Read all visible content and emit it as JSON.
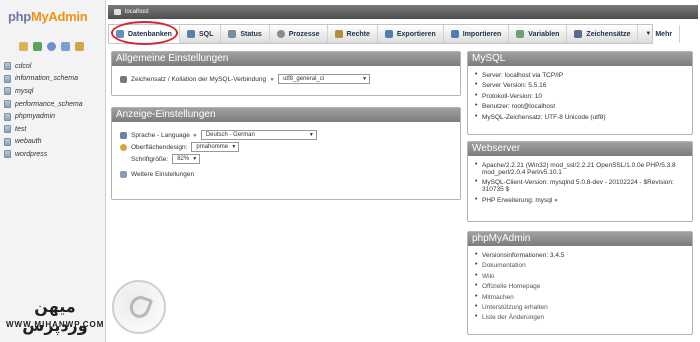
{
  "brand": {
    "php": "php",
    "myadmin": "MyAdmin"
  },
  "left_icons": [
    "home-icon",
    "exit-icon",
    "help-icon",
    "docs-icon",
    "settings-icon"
  ],
  "databases": [
    "cdcol",
    "information_schema",
    "mysql",
    "performance_schema",
    "phpmyadmin",
    "test",
    "webauth",
    "wordpress"
  ],
  "watermark": {
    "text": "میهن وردپرس",
    "url": "WWW.MIHANWP.COM"
  },
  "server_bar": {
    "label": "localhost"
  },
  "tabs": [
    {
      "label": "Datenbanken",
      "icon": "database-icon",
      "color": "#6b8fb7"
    },
    {
      "label": "SQL",
      "icon": "sql-icon",
      "color": "#5a7fa8"
    },
    {
      "label": "Status",
      "icon": "status-icon",
      "color": "#7a8aa0"
    },
    {
      "label": "Prozesse",
      "icon": "process-icon",
      "color": "#8a8a8a"
    },
    {
      "label": "Rechte",
      "icon": "rights-icon",
      "color": "#b0903a"
    },
    {
      "label": "Exportieren",
      "icon": "export-icon",
      "color": "#4f7fb0"
    },
    {
      "label": "Importieren",
      "icon": "import-icon",
      "color": "#4f7fb0"
    },
    {
      "label": "Variablen",
      "icon": "variables-icon",
      "color": "#6fa06f"
    },
    {
      "label": "Zeichensätze",
      "icon": "charset-icon",
      "color": "#5a6a8a"
    },
    {
      "label": "Mehr",
      "icon": "more-icon",
      "color": "#333333"
    }
  ],
  "general": {
    "title": "Allgemeine Einstellungen",
    "collation_label": "Zeichensatz / Kollation der MySQL-Verbindung",
    "collation_value": "utf8_general_ci"
  },
  "appearance": {
    "title": "Anzeige-Einstellungen",
    "language_label": "Sprache - Language",
    "language_value": "Deutsch - German",
    "theme_label": "Oberflächendesign:",
    "theme_value": "pmahomme",
    "fontsize_label": "Schriftgröße:",
    "fontsize_value": "82%",
    "more_settings": "Weitere Einstellungen"
  },
  "mysql": {
    "title": "MySQL",
    "items": [
      "Server: localhost via TCP/IP",
      "Server Version: 5.5.16",
      "Protokoll-Version: 10",
      "Benutzer: root@localhost",
      "MySQL-Zeichensatz: UTF-8 Unicode (utf8)"
    ]
  },
  "webserver": {
    "title": "Webserver",
    "items": [
      "Apache/2.2.21 (Win32) mod_ssl/2.2.21 OpenSSL/1.0.0e PHP/5.3.8 mod_perl/2.0.4 Perl/v5.10.1",
      "MySQL-Client-Version: mysqlnd 5.0.8-dev - 20102224 - $Revision: 310735 $",
      "PHP Erweiterung: mysql"
    ]
  },
  "pma": {
    "title": "phpMyAdmin",
    "items": [
      "Versionsinformationen: 3.4.5",
      "Dokumentation",
      "Wiki",
      "Offizielle Homepage",
      "Mitmachen",
      "Unterstützung erhalten",
      "Liste der Änderungen"
    ]
  }
}
